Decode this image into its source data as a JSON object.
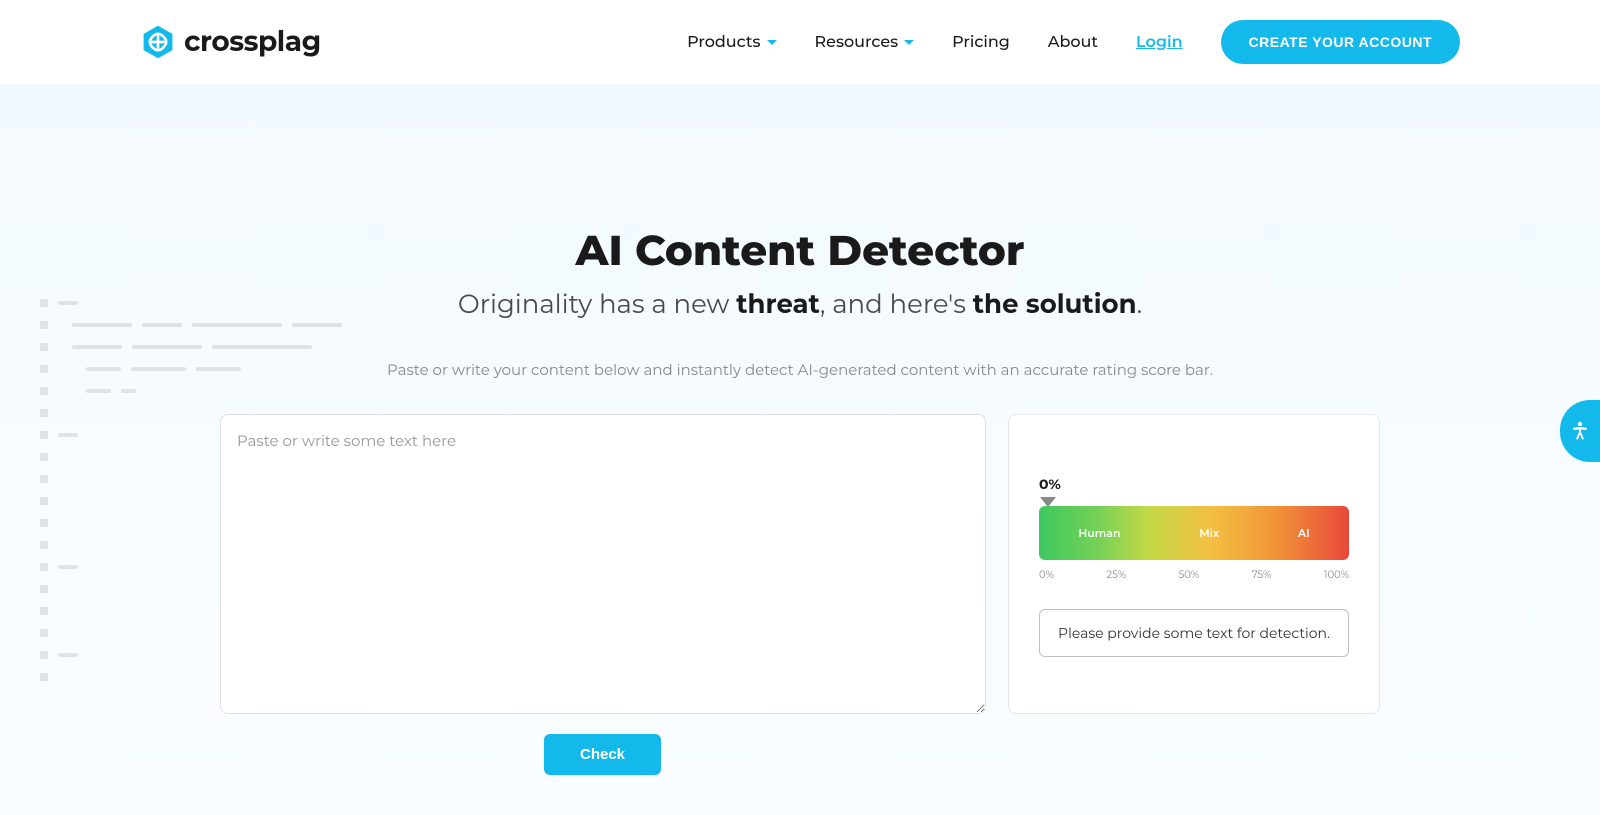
{
  "brand": {
    "name": "crossplag"
  },
  "nav": {
    "products": "Products",
    "resources": "Resources",
    "pricing": "Pricing",
    "about": "About",
    "login": "Login",
    "cta": "CREATE YOUR ACCOUNT"
  },
  "hero": {
    "title": "AI Content Detector",
    "sub_prefix": "Originality has a new ",
    "sub_bold1": "threat",
    "sub_mid": ", and here's ",
    "sub_bold2": "the solution",
    "sub_suffix": ".",
    "description": "Paste or write your content below and instantly detect AI-generated content with an accurate rating score bar."
  },
  "editor": {
    "placeholder": "Paste or write some text here",
    "check_label": "Check"
  },
  "gauge": {
    "percent": "0%",
    "label_human": "Human",
    "label_mix": "Mix",
    "label_ai": "AI",
    "tick_0": "0%",
    "tick_25": "25%",
    "tick_50": "50%",
    "tick_75": "75%",
    "tick_100": "100%",
    "message": "Please provide some text for detection."
  }
}
